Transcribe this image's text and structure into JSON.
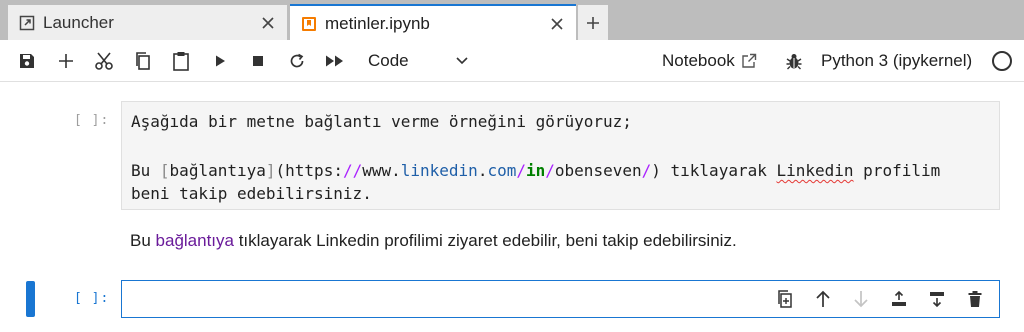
{
  "tabs": [
    {
      "label": "Launcher",
      "icon": "external-launcher-icon",
      "active": false
    },
    {
      "label": "metinler.ipynb",
      "icon": "notebook-icon",
      "active": true
    }
  ],
  "toolbar": {
    "cell_type": "Code",
    "notebook_link": "Notebook",
    "kernel_name": "Python 3 (ipykernel)",
    "buttons": [
      "save",
      "insert-cell",
      "cut",
      "copy",
      "paste",
      "run",
      "interrupt",
      "restart",
      "restart-run-all"
    ]
  },
  "cells": {
    "markdown": {
      "prompt": "[ ]:",
      "source_line1": "Aşağıda bir metne bağlantı verme örneğini görüyoruz;",
      "src": {
        "bracket_open": "[",
        "link_text": "bağlantıya",
        "bracket_close": "]",
        "paren_open": "(",
        "scheme": "https:",
        "slash1": "//",
        "www": "www.",
        "host": "linkedin",
        "dot": ".",
        "tld": "com",
        "slash2": "/",
        "path_in": "in",
        "slash3": "/",
        "path_user": "obenseven",
        "slash4": "/",
        "paren_close": ")",
        "prefix": "Bu ",
        "after_link": " tıklayarak ",
        "spell_word": "Linkedin",
        "tail": " profilim"
      },
      "source_line3": "beni takip edebilirsiniz.",
      "rendered": {
        "prefix": "Bu ",
        "link": "bağlantıya",
        "suffix": " tıklayarak Linkedin profilimi ziyaret edebilir, beni takip edebilirsiniz."
      }
    },
    "code": {
      "prompt": "[ ]:",
      "value": ""
    }
  },
  "colors": {
    "accent": "#1976d2",
    "tab_bar": "#bdbdbd",
    "link_visited": "#6a1b9a"
  }
}
